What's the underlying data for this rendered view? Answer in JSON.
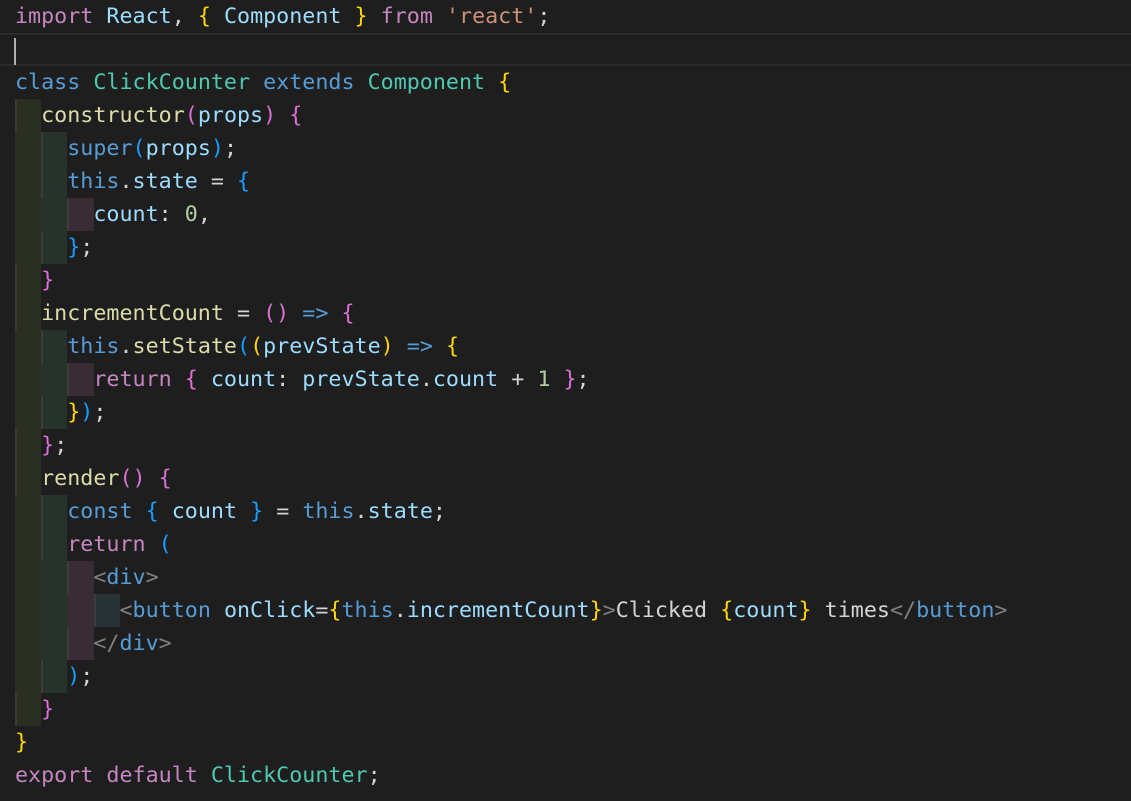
{
  "editor": {
    "colors": {
      "background": "#1e1e1e",
      "keyword_control": "#c586c0",
      "keyword_storage": "#569cd6",
      "class_name": "#4ec9b0",
      "variable": "#9cdcfe",
      "function": "#dcdcaa",
      "string": "#ce9178",
      "number": "#b5cea8",
      "bracket_level_1": "#ffd700",
      "bracket_level_2": "#da70d6",
      "bracket_level_3": "#179fff"
    },
    "lines": [
      [
        [
          "kw",
          "import"
        ],
        [
          "pun",
          " "
        ],
        [
          "var",
          "React"
        ],
        [
          "pun",
          ", "
        ],
        [
          "b1",
          "{"
        ],
        [
          "pun",
          " "
        ],
        [
          "var",
          "Component"
        ],
        [
          "pun",
          " "
        ],
        [
          "b1",
          "}"
        ],
        [
          "pun",
          " "
        ],
        [
          "kw",
          "from"
        ],
        [
          "pun",
          " "
        ],
        [
          "str",
          "'react'"
        ],
        [
          "pun",
          ";"
        ]
      ],
      [],
      [
        [
          "st",
          "class"
        ],
        [
          "pun",
          " "
        ],
        [
          "cls",
          "ClickCounter"
        ],
        [
          "pun",
          " "
        ],
        [
          "st",
          "extends"
        ],
        [
          "pun",
          " "
        ],
        [
          "cls",
          "Component"
        ],
        [
          "pun",
          " "
        ],
        [
          "b1",
          "{"
        ]
      ],
      [
        [
          "pun",
          "  "
        ],
        [
          "fn",
          "constructor"
        ],
        [
          "b2",
          "("
        ],
        [
          "var",
          "props"
        ],
        [
          "b2",
          ")"
        ],
        [
          "pun",
          " "
        ],
        [
          "b2",
          "{"
        ]
      ],
      [
        [
          "pun",
          "    "
        ],
        [
          "st",
          "super"
        ],
        [
          "b3",
          "("
        ],
        [
          "var",
          "props"
        ],
        [
          "b3",
          ")"
        ],
        [
          "pun",
          ";"
        ]
      ],
      [
        [
          "pun",
          "    "
        ],
        [
          "st",
          "this"
        ],
        [
          "pun",
          "."
        ],
        [
          "var",
          "state"
        ],
        [
          "pun",
          " = "
        ],
        [
          "b3",
          "{"
        ]
      ],
      [
        [
          "pun",
          "      "
        ],
        [
          "var",
          "count"
        ],
        [
          "pun",
          ": "
        ],
        [
          "num",
          "0"
        ],
        [
          "pun",
          ","
        ]
      ],
      [
        [
          "pun",
          "    "
        ],
        [
          "b3",
          "}"
        ],
        [
          "pun",
          ";"
        ]
      ],
      [
        [
          "pun",
          "  "
        ],
        [
          "b2",
          "}"
        ]
      ],
      [
        [
          "pun",
          "  "
        ],
        [
          "fn",
          "incrementCount"
        ],
        [
          "pun",
          " = "
        ],
        [
          "b2",
          "()"
        ],
        [
          "pun",
          " "
        ],
        [
          "st",
          "=>"
        ],
        [
          "pun",
          " "
        ],
        [
          "b2",
          "{"
        ]
      ],
      [
        [
          "pun",
          "    "
        ],
        [
          "st",
          "this"
        ],
        [
          "pun",
          "."
        ],
        [
          "fn",
          "setState"
        ],
        [
          "b3",
          "("
        ],
        [
          "b1",
          "("
        ],
        [
          "var",
          "prevState"
        ],
        [
          "b1",
          ")"
        ],
        [
          "pun",
          " "
        ],
        [
          "st",
          "=>"
        ],
        [
          "pun",
          " "
        ],
        [
          "b1",
          "{"
        ]
      ],
      [
        [
          "pun",
          "      "
        ],
        [
          "kw",
          "return"
        ],
        [
          "pun",
          " "
        ],
        [
          "b2",
          "{"
        ],
        [
          "pun",
          " "
        ],
        [
          "var",
          "count"
        ],
        [
          "pun",
          ": "
        ],
        [
          "var",
          "prevState"
        ],
        [
          "pun",
          "."
        ],
        [
          "var",
          "count"
        ],
        [
          "pun",
          " + "
        ],
        [
          "num",
          "1"
        ],
        [
          "pun",
          " "
        ],
        [
          "b2",
          "}"
        ],
        [
          "pun",
          ";"
        ]
      ],
      [
        [
          "pun",
          "    "
        ],
        [
          "b1",
          "}"
        ],
        [
          "b3",
          ")"
        ],
        [
          "pun",
          ";"
        ]
      ],
      [
        [
          "pun",
          "  "
        ],
        [
          "b2",
          "}"
        ],
        [
          "pun",
          ";"
        ]
      ],
      [
        [
          "pun",
          "  "
        ],
        [
          "fn",
          "render"
        ],
        [
          "b2",
          "()"
        ],
        [
          "pun",
          " "
        ],
        [
          "b2",
          "{"
        ]
      ],
      [
        [
          "pun",
          "    "
        ],
        [
          "st",
          "const"
        ],
        [
          "pun",
          " "
        ],
        [
          "b3",
          "{"
        ],
        [
          "pun",
          " "
        ],
        [
          "var",
          "count"
        ],
        [
          "pun",
          " "
        ],
        [
          "b3",
          "}"
        ],
        [
          "pun",
          " = "
        ],
        [
          "st",
          "this"
        ],
        [
          "pun",
          "."
        ],
        [
          "var",
          "state"
        ],
        [
          "pun",
          ";"
        ]
      ],
      [
        [
          "pun",
          "    "
        ],
        [
          "kw",
          "return"
        ],
        [
          "pun",
          " "
        ],
        [
          "b3",
          "("
        ]
      ],
      [
        [
          "pun",
          "      "
        ],
        [
          "tagb",
          "<"
        ],
        [
          "tag",
          "div"
        ],
        [
          "tagb",
          ">"
        ]
      ],
      [
        [
          "pun",
          "        "
        ],
        [
          "tagb",
          "<"
        ],
        [
          "tag",
          "button"
        ],
        [
          "pun",
          " "
        ],
        [
          "var",
          "onClick"
        ],
        [
          "pun",
          "="
        ],
        [
          "b1",
          "{"
        ],
        [
          "st",
          "this"
        ],
        [
          "pun",
          "."
        ],
        [
          "var",
          "incrementCount"
        ],
        [
          "b1",
          "}"
        ],
        [
          "tagb",
          ">"
        ],
        [
          "txt",
          "Clicked "
        ],
        [
          "b1",
          "{"
        ],
        [
          "var",
          "count"
        ],
        [
          "b1",
          "}"
        ],
        [
          "txt",
          " times"
        ],
        [
          "tagb",
          "</"
        ],
        [
          "tag",
          "button"
        ],
        [
          "tagb",
          ">"
        ]
      ],
      [
        [
          "pun",
          "      "
        ],
        [
          "tagb",
          "</"
        ],
        [
          "tag",
          "div"
        ],
        [
          "tagb",
          ">"
        ]
      ],
      [
        [
          "pun",
          "    "
        ],
        [
          "b3",
          ")"
        ],
        [
          "pun",
          ";"
        ]
      ],
      [
        [
          "pun",
          "  "
        ],
        [
          "b2",
          "}"
        ]
      ],
      [
        [
          "b1",
          "}"
        ]
      ],
      [
        [
          "kw",
          "export"
        ],
        [
          "pun",
          " "
        ],
        [
          "kw",
          "default"
        ],
        [
          "pun",
          " "
        ],
        [
          "cls",
          "ClickCounter"
        ],
        [
          "pun",
          ";"
        ]
      ]
    ]
  }
}
